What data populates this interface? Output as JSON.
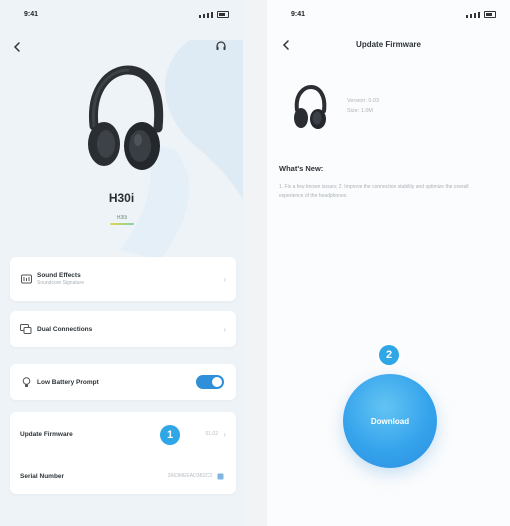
{
  "left_screen": {
    "status": {
      "time": "9:41"
    },
    "device": {
      "name": "H30i",
      "badge": "H30i"
    },
    "settings": {
      "sound_effects": {
        "label": "Sound Effects",
        "subtitle": "Soundcore Signature"
      },
      "dual_connections": {
        "label": "Dual Connections"
      },
      "low_battery_prompt": {
        "label": "Low Battery Prompt",
        "enabled": true
      },
      "update_firmware": {
        "label": "Update Firmware",
        "value": "01.02"
      },
      "serial_number": {
        "label": "Serial Number",
        "value": "3663MEEAD3B2C3"
      }
    },
    "step_marker": "1"
  },
  "right_screen": {
    "status": {
      "time": "9:41"
    },
    "title": "Update Firmware",
    "firmware": {
      "version": "Version: 0.03",
      "size": "Size: 1.0M"
    },
    "whats_new_heading": "What's New:",
    "release_notes": "1. Fix a few known issues; 2. Improve the connection stability and optimize the overall experience of the headphones.",
    "download_label": "Download",
    "step_marker": "2"
  },
  "colors": {
    "accent": "#2f8fd8",
    "step_badge": "#2fa6e6",
    "left_background": "#eef3f7",
    "right_background": "#fbfcfd"
  }
}
